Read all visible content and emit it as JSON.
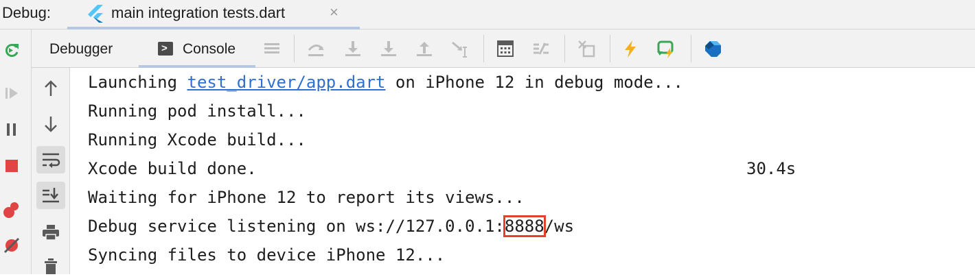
{
  "topbar": {
    "debug_label": "Debug:",
    "file_tab": "main integration tests.dart",
    "close_glyph": "×"
  },
  "toolbar": {
    "tabs": [
      {
        "label": "Debugger"
      },
      {
        "label": "Console",
        "active": true
      }
    ],
    "icons": [
      "menu-icon",
      "step-over-icon",
      "step-into-icon",
      "force-step-into-icon",
      "step-out-icon",
      "run-to-cursor-icon",
      "evaluate-expression-icon",
      "trace-icon",
      "restore-layout-icon",
      "hot-reload-icon",
      "hot-restart-icon",
      "dart-devtools-icon"
    ]
  },
  "left_gutter": {
    "icons": [
      "rerun-icon",
      "resume-icon",
      "pause-icon",
      "stop-icon",
      "view-breakpoints-icon",
      "mute-breakpoints-icon"
    ]
  },
  "console_gutter": {
    "icons": [
      "scroll-up-icon",
      "scroll-down-icon",
      "soft-wrap-icon",
      "scroll-to-end-icon",
      "print-icon",
      "clear-all-icon"
    ]
  },
  "console": {
    "lines": [
      {
        "prefix": "Launching ",
        "link": "test_driver/app.dart",
        "suffix": " on iPhone 12 in debug mode..."
      },
      {
        "text": "Running pod install..."
      },
      {
        "text": "Running Xcode build..."
      },
      {
        "text": "Xcode build done.",
        "timing": "30.4s"
      },
      {
        "text": "Waiting for iPhone 12 to report its views..."
      },
      {
        "prefix": "Debug service listening on ws://127.0.0.1:",
        "highlight": "8888",
        "suffix": "/ws"
      },
      {
        "text": "Syncing files to device iPhone 12..."
      }
    ]
  },
  "colors": {
    "accent_underline": "#b8c7e0",
    "link": "#2f6fd1",
    "highlight_box": "#e2412b",
    "flutter_blue": "#54c5f8",
    "hot_reload": "#f2b01e",
    "hot_restart": "#3aa657",
    "stop": "#e04444"
  }
}
